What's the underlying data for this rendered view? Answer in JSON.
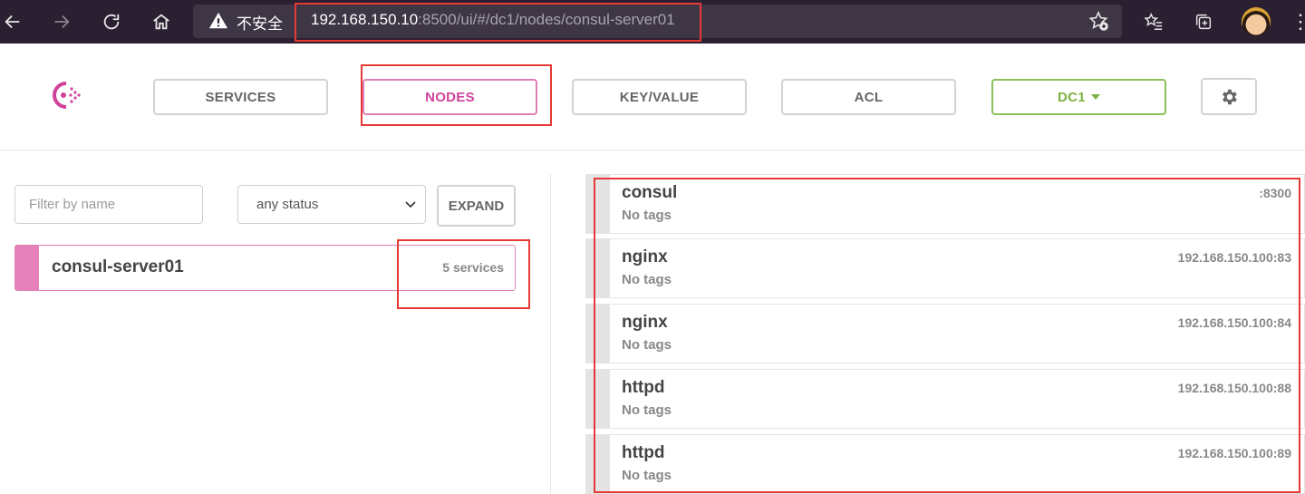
{
  "browser": {
    "insecure_label": "不安全",
    "url_host": "192.168.150.10",
    "url_rest": ":8500/ui/#/dc1/nodes/consul-server01",
    "icons": [
      "back-icon",
      "forward-icon",
      "reload-icon",
      "home-icon",
      "warning-icon",
      "add-favorite-icon",
      "favorites-icon",
      "collections-icon",
      "profile-avatar",
      "more-icon"
    ]
  },
  "nav": {
    "services": "SERVICES",
    "nodes": "NODES",
    "key_value": "KEY/VALUE",
    "acl": "ACL",
    "datacenter": "DC1"
  },
  "filters": {
    "name_placeholder": "Filter by name",
    "status_selected": "any status",
    "expand_label": "EXPAND"
  },
  "node": {
    "name": "consul-server01",
    "services_count": "5 services"
  },
  "services": [
    {
      "name": "consul",
      "tags": "No tags",
      "address": ":8300"
    },
    {
      "name": "nginx",
      "tags": "No tags",
      "address": "192.168.150.100:83"
    },
    {
      "name": "nginx",
      "tags": "No tags",
      "address": "192.168.150.100:84"
    },
    {
      "name": "httpd",
      "tags": "No tags",
      "address": "192.168.150.100:88"
    },
    {
      "name": "httpd",
      "tags": "No tags",
      "address": "192.168.150.100:89"
    }
  ],
  "colors": {
    "brand_pink": "#d0439a",
    "dc_green": "#7cb342",
    "annotation_red": "#e53935"
  }
}
